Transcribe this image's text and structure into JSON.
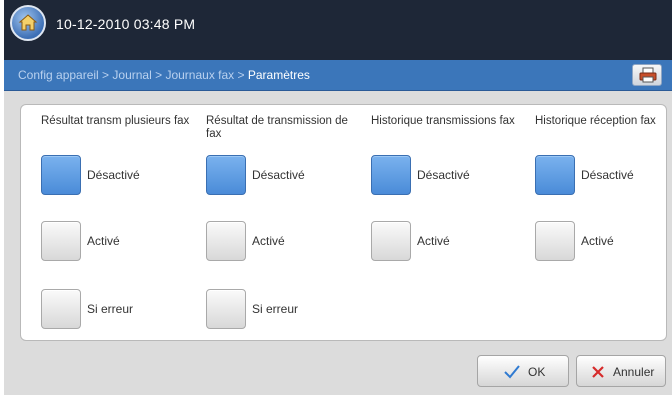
{
  "header": {
    "datetime": "10-12-2010 03:48 PM"
  },
  "breadcrumb": {
    "items": [
      "Config appareil",
      "Journal",
      "Journaux fax"
    ],
    "separator": " > ",
    "current": "Paramètres"
  },
  "columns": [
    {
      "title": "Résultat transm plusieurs fax",
      "selected": "Désactivé",
      "options": [
        "Désactivé",
        "Activé",
        "Si erreur"
      ]
    },
    {
      "title": "Résultat de transmission de fax",
      "selected": "Désactivé",
      "options": [
        "Désactivé",
        "Activé",
        "Si erreur"
      ]
    },
    {
      "title": "Historique transmissions fax",
      "selected": "Désactivé",
      "options": [
        "Désactivé",
        "Activé"
      ]
    },
    {
      "title": "Historique réception fax",
      "selected": "Désactivé",
      "options": [
        "Désactivé",
        "Activé"
      ]
    }
  ],
  "footer": {
    "ok_label": "OK",
    "cancel_label": "Annuler"
  },
  "colors": {
    "topbar": "#1e2737",
    "navbar": "#3b76ba",
    "selected": "#4a8bd8",
    "ok_check": "#2f7ad1",
    "cancel_x": "#d62b2b"
  },
  "icons": {
    "home": "home-icon",
    "nav": "printer-icon",
    "ok": "check-icon",
    "cancel": "x-icon"
  }
}
